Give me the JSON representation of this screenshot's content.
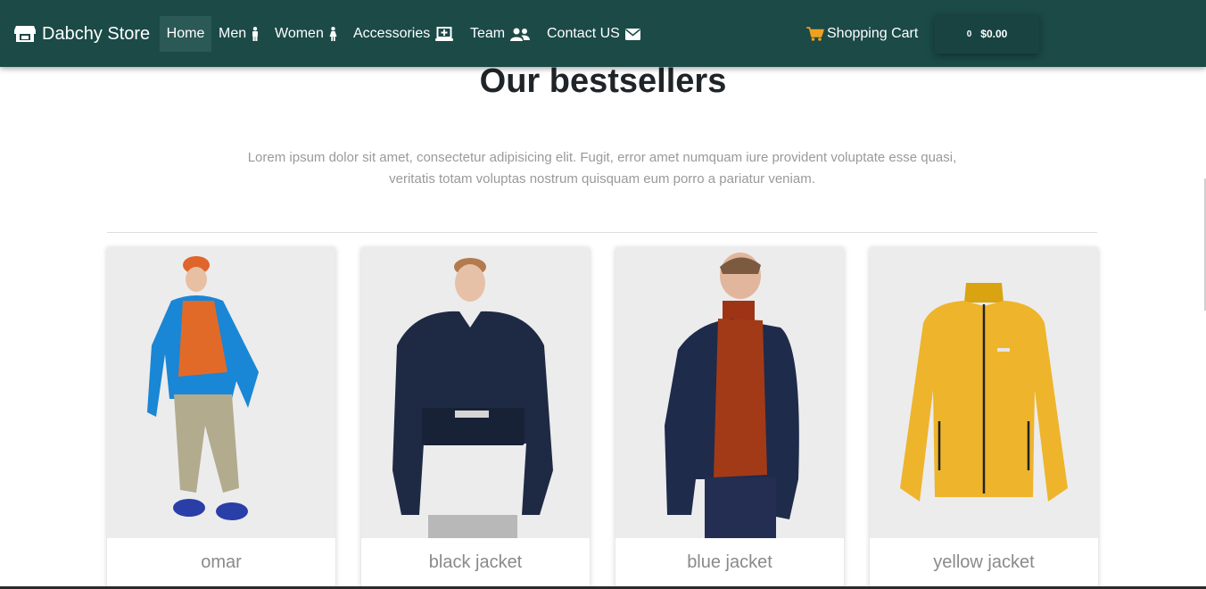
{
  "brand": {
    "name": "Dabchy Store",
    "icon": "store-icon"
  },
  "nav": {
    "items": [
      {
        "label": "Home",
        "icon": ""
      },
      {
        "label": "Men",
        "icon": "male-icon"
      },
      {
        "label": "Women",
        "icon": "female-icon"
      },
      {
        "label": "Accessories",
        "icon": "laptop-medical-icon"
      },
      {
        "label": "Team",
        "icon": "users-icon"
      },
      {
        "label": "Contact US",
        "icon": "envelope-icon"
      }
    ],
    "cart_label": "Shopping Cart",
    "cart_count": "0",
    "cart_total": "$0.00"
  },
  "main": {
    "title": "Our bestsellers",
    "description": "Lorem ipsum dolor sit amet, consectetur adipisicing elit. Fugit, error amet numquam iure provident voluptate esse quasi, veritatis totam voluptas nostrum quisquam eum porro a pariatur veniam.",
    "products": [
      {
        "name": "omar"
      },
      {
        "name": "black jacket"
      },
      {
        "name": "blue jacket"
      },
      {
        "name": "yellow jacket"
      }
    ]
  },
  "colors": {
    "navbar": "#1b4a47",
    "cart_icon": "#f0a020",
    "active_tab": "#2b5956"
  }
}
